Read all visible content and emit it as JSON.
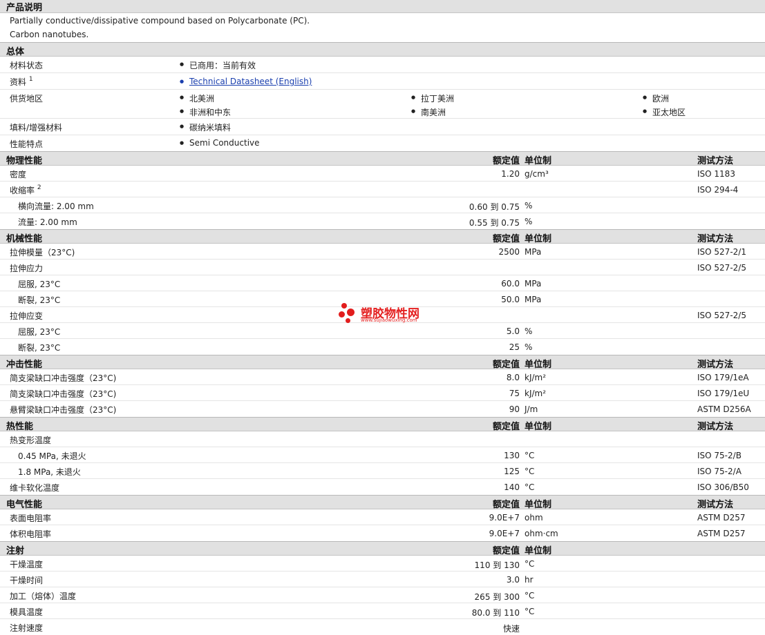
{
  "desc": {
    "title": "产品说明",
    "line1": "Partially conductive/dissipative compound based on Polycarbonate (PC).",
    "line2": "Carbon nanotubes."
  },
  "general": {
    "title": "总体",
    "status_label": "材料状态",
    "status_value": "已商用：当前有效",
    "docs_label": "资料",
    "docs_sup": "1",
    "docs_link": "Technical Datasheet (English)",
    "regions_label": "供货地区",
    "regions": [
      "北美洲",
      "拉丁美洲",
      "欧洲",
      "非洲和中东",
      "南美洲",
      "亚太地区"
    ],
    "filler_label": "填料/增强材料",
    "filler_value": "碳纳米填料",
    "feature_label": "性能特点",
    "feature_value": "Semi Conductive"
  },
  "headers": {
    "value": "额定值",
    "unit": "单位制",
    "method": "测试方法"
  },
  "physical": {
    "title": "物理性能",
    "density": {
      "name": "密度",
      "value": "1.20",
      "unit": "g/cm³",
      "method": "ISO 1183"
    },
    "shrink": {
      "name": "收缩率",
      "sup": "2",
      "method": "ISO 294-4"
    },
    "shrink_t": {
      "name": "横向流量: 2.00 mm",
      "value": "0.60 到  0.75",
      "unit": "%"
    },
    "shrink_f": {
      "name": "流量: 2.00 mm",
      "value": "0.55 到  0.75",
      "unit": "%"
    }
  },
  "mechanical": {
    "title": "机械性能",
    "modulus": {
      "name": "拉伸模量（23°C)",
      "value": "2500",
      "unit": "MPa",
      "method": "ISO 527-2/1"
    },
    "stress": {
      "name": "拉伸应力",
      "method": "ISO 527-2/5"
    },
    "stress_y": {
      "name": "屈服, 23°C",
      "value": "60.0",
      "unit": "MPa"
    },
    "stress_b": {
      "name": "断裂, 23°C",
      "value": "50.0",
      "unit": "MPa"
    },
    "strain": {
      "name": "拉伸应变",
      "method": "ISO 527-2/5"
    },
    "strain_y": {
      "name": "屈服, 23°C",
      "value": "5.0",
      "unit": "%"
    },
    "strain_b": {
      "name": "断裂, 23°C",
      "value": "25",
      "unit": "%"
    }
  },
  "impact": {
    "title": "冲击性能",
    "r1": {
      "name": "简支梁缺口冲击强度（23°C)",
      "value": "8.0",
      "unit": "kJ/m²",
      "method": "ISO 179/1eA"
    },
    "r2": {
      "name": "简支梁缺口冲击强度（23°C)",
      "value": "75",
      "unit": "kJ/m²",
      "method": "ISO 179/1eU"
    },
    "r3": {
      "name": "悬臂梁缺口冲击强度（23°C)",
      "value": "90",
      "unit": "J/m",
      "method": "ASTM D256A"
    }
  },
  "thermal": {
    "title": "热性能",
    "hdt": {
      "name": "热变形温度"
    },
    "hdt1": {
      "name": "0.45 MPa, 未退火",
      "value": "130",
      "unit": "°C",
      "method": "ISO 75-2/B"
    },
    "hdt2": {
      "name": "1.8 MPa, 未退火",
      "value": "125",
      "unit": "°C",
      "method": "ISO 75-2/A"
    },
    "vicat": {
      "name": "维卡软化温度",
      "value": "140",
      "unit": "°C",
      "method": "ISO 306/B50"
    }
  },
  "electrical": {
    "title": "电气性能",
    "surf": {
      "name": "表面电阻率",
      "value": "9.0E+7",
      "unit": "ohm",
      "method": "ASTM D257"
    },
    "vol": {
      "name": "体积电阻率",
      "value": "9.0E+7",
      "unit": "ohm·cm",
      "method": "ASTM D257"
    }
  },
  "injection": {
    "title": "注射",
    "dry_t": {
      "name": "干燥温度",
      "value": "110 到  130",
      "unit": "°C"
    },
    "dry_h": {
      "name": "干燥时间",
      "value": "3.0",
      "unit": "hr"
    },
    "melt": {
      "name": "加工（熔体）温度",
      "value": "265 到  300",
      "unit": "°C"
    },
    "mold": {
      "name": "模具温度",
      "value": "80.0 到  110",
      "unit": "°C"
    },
    "speed": {
      "name": "注射速度",
      "value": "快速"
    }
  },
  "watermark": {
    "cn": "塑胶物性网",
    "en": "www.sujiaowuxing.com"
  }
}
